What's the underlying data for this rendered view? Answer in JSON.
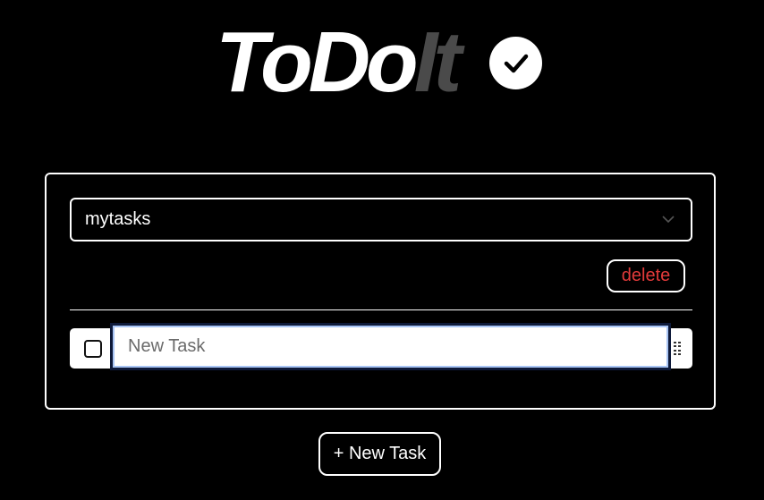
{
  "header": {
    "logo_text_primary": "ToDo",
    "logo_text_secondary": "It",
    "logo_icon": "checkmark-circle-icon"
  },
  "list_selector": {
    "selected": "mytasks",
    "icon": "chevron-down-icon"
  },
  "actions": {
    "delete_label": "delete"
  },
  "tasks": [
    {
      "text": "",
      "placeholder": "New Task",
      "checked": false
    }
  ],
  "footer": {
    "new_task_label": "+ New Task"
  },
  "colors": {
    "background": "#000000",
    "foreground": "#ffffff",
    "logo_secondary": "#4a4a4a",
    "delete": "#e23a3a",
    "focus_ring": "#a9c5f5"
  }
}
